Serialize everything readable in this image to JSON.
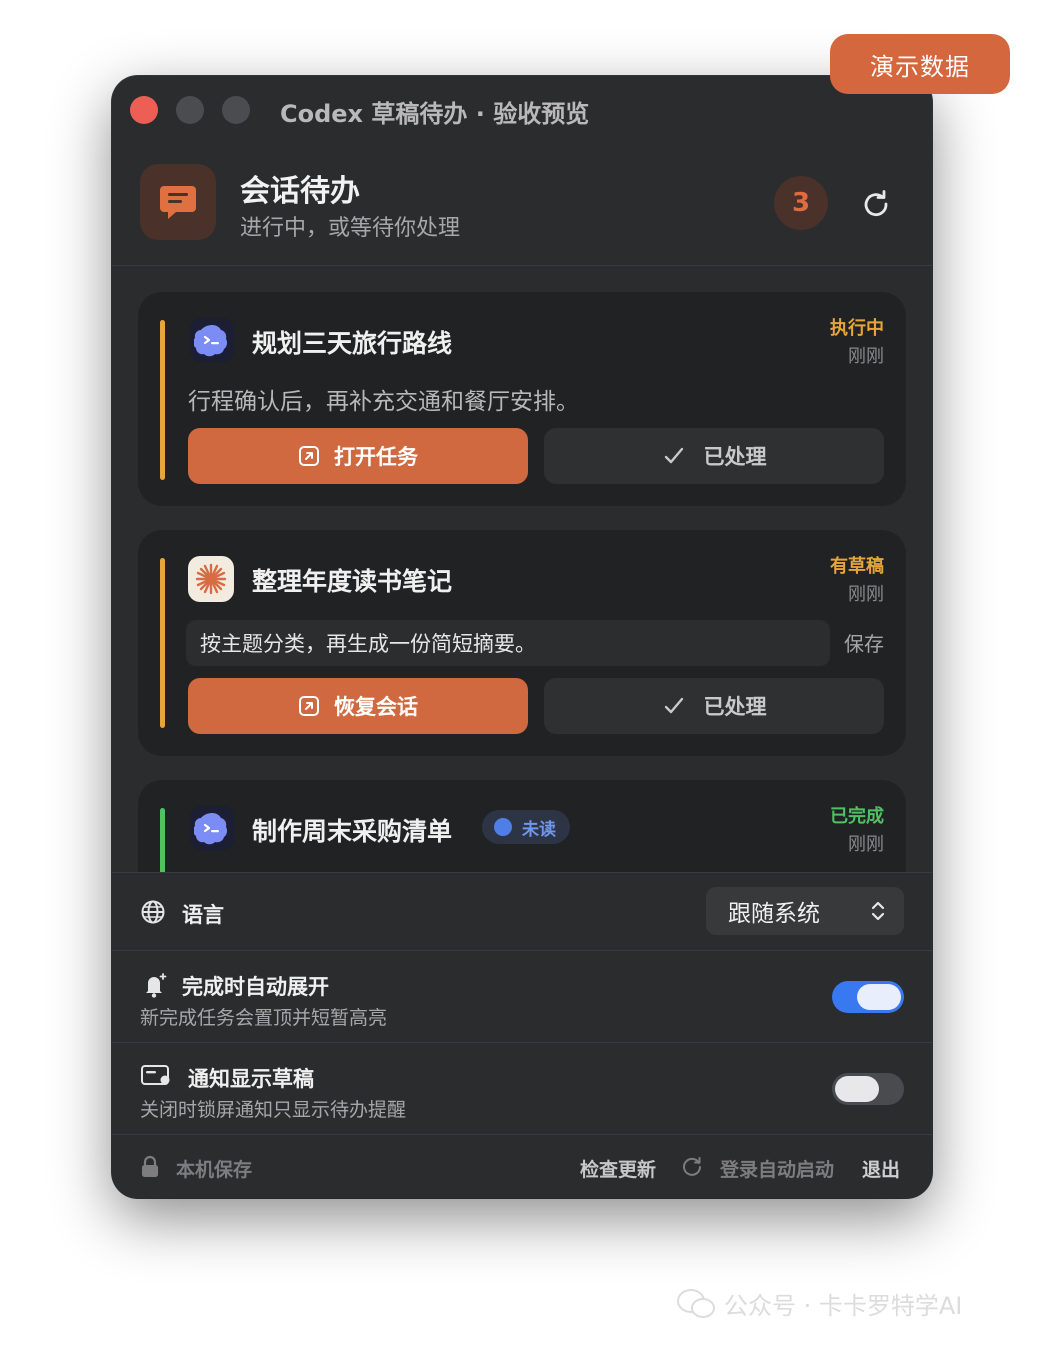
{
  "demo_badge": "演示数据",
  "window": {
    "title": "Codex 草稿待办 · 验收预览"
  },
  "header": {
    "title": "会话待办",
    "subtitle": "进行中，或等待你处理",
    "count": "3",
    "icon": "chat-bubble-icon"
  },
  "tasks": [
    {
      "title": "规划三天旅行路线",
      "status": "执行中",
      "status_color": "#e6a53a",
      "time": "刚刚",
      "description": "行程确认后，再补充交通和餐厅安排。",
      "primary_label": "打开任务",
      "secondary_label": "已处理",
      "icon": "codex-terminal-icon"
    },
    {
      "title": "整理年度读书笔记",
      "status": "有草稿",
      "status_color": "#e6a53a",
      "time": "刚刚",
      "draft_value": "按主题分类，再生成一份简短摘要。",
      "save_label": "保存",
      "primary_label": "恢复会话",
      "secondary_label": "已处理",
      "icon": "claude-starburst-icon"
    },
    {
      "title": "制作周末采购清单",
      "status": "已完成",
      "status_color": "#4fc063",
      "time": "刚刚",
      "badge": "未读",
      "icon": "codex-terminal-icon"
    }
  ],
  "settings": {
    "language": {
      "label": "语言",
      "value": "跟随系统"
    },
    "auto_expand": {
      "label": "完成时自动展开",
      "sub": "新完成任务会置顶并短暂高亮",
      "enabled": true
    },
    "notify_draft": {
      "label": "通知显示草稿",
      "sub": "关闭时锁屏通知只显示待办提醒",
      "enabled": false
    }
  },
  "footer": {
    "local_save": "本机保存",
    "check_update": "检查更新",
    "login_launch": "登录自动启动",
    "quit": "退出"
  },
  "watermark": "公众号 · 卡卡罗特学AI"
}
